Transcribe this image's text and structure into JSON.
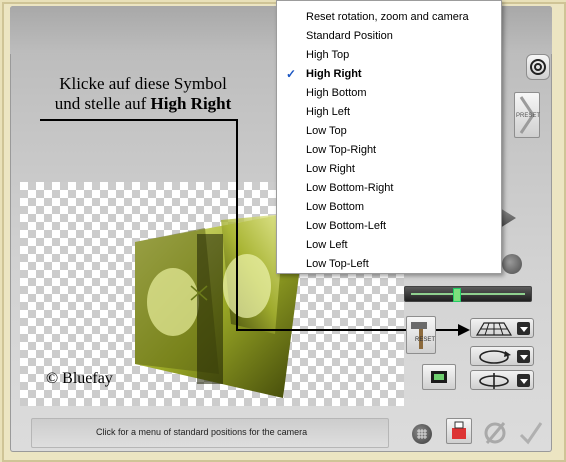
{
  "annotation": {
    "line1": "Klicke auf diese Symbol",
    "line2_prefix": "und stelle auf ",
    "line2_strong": "High Right"
  },
  "credit": "© Bluefay",
  "status_text": "Click for a menu of standard positions for the camera",
  "menu": {
    "items": [
      {
        "label": "Reset rotation, zoom and camera",
        "checked": false
      },
      {
        "label": "Standard Position",
        "checked": false
      },
      {
        "label": "High Top",
        "checked": false
      },
      {
        "label": "High Right",
        "checked": true
      },
      {
        "label": "High Bottom",
        "checked": false
      },
      {
        "label": "High Left",
        "checked": false
      },
      {
        "label": "Low Top",
        "checked": false
      },
      {
        "label": "Low Top-Right",
        "checked": false
      },
      {
        "label": "Low Right",
        "checked": false
      },
      {
        "label": "Low Bottom-Right",
        "checked": false
      },
      {
        "label": "Low Bottom",
        "checked": false
      },
      {
        "label": "Low Bottom-Left",
        "checked": false
      },
      {
        "label": "Low Left",
        "checked": false
      },
      {
        "label": "Low Top-Left",
        "checked": false
      }
    ],
    "check_mark": "✓"
  },
  "buttons": {
    "preset_label": "PRESET",
    "reset_label": "RESET"
  },
  "slider": {
    "value_fraction": 0.41
  },
  "colors": {
    "accent_check": "#1b56c2",
    "slider_green": "#7dde7d",
    "photo_tint": "#b8c42a"
  }
}
